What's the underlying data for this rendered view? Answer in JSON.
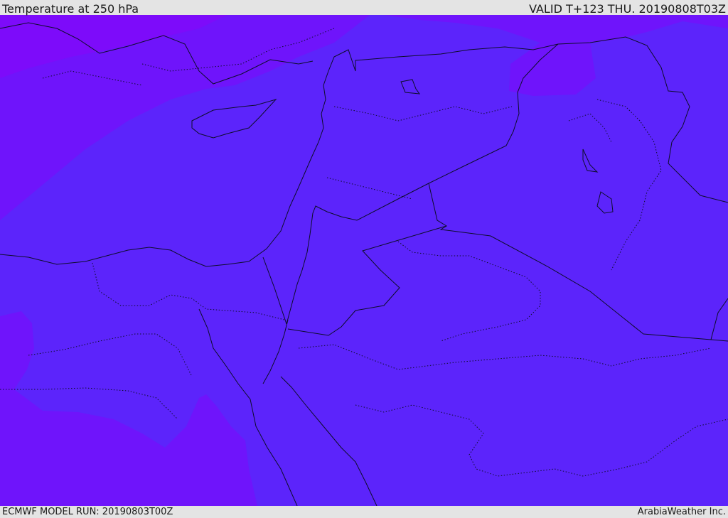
{
  "header": {
    "title": "Temperature at 250 hPa",
    "valid_time": "VALID T+123 THU. 20190808T03Z"
  },
  "footer": {
    "model_run": "ECMWF MODEL RUN: 20190803T00Z",
    "credit": "ArabiaWeather Inc."
  },
  "map": {
    "variable": "temperature",
    "level": "250 hPa",
    "colors": {
      "coldest_band": "#7d0bfa",
      "cold_band": "#6f14fb",
      "mid_band": "#5c24fb",
      "border": "#0d0d2a"
    }
  }
}
